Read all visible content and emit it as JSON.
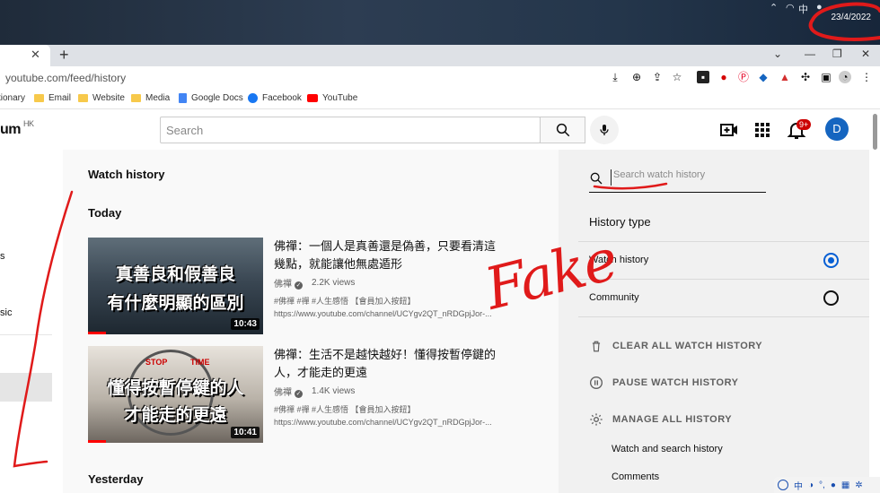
{
  "desktop": {
    "date": "23/4/2022",
    "ime_indicator": "中"
  },
  "browser": {
    "url": "youtube.com/feed/history",
    "bookmarks": [
      {
        "label": "tionary",
        "icon": "folder-icon"
      },
      {
        "label": "Email",
        "icon": "folder-icon"
      },
      {
        "label": "Website",
        "icon": "folder-icon"
      },
      {
        "label": "Media",
        "icon": "folder-icon"
      },
      {
        "label": "Google Docs",
        "icon": "google-docs-icon"
      },
      {
        "label": "Facebook",
        "icon": "facebook-icon"
      },
      {
        "label": "YouTube",
        "icon": "youtube-icon"
      }
    ]
  },
  "youtube": {
    "logo_fragment": "um",
    "region": "HK",
    "search_placeholder": "Search",
    "notification_count": "9+",
    "avatar_letter": "D",
    "sidebar_fragments": [
      "s",
      "sic"
    ]
  },
  "history": {
    "page_title": "Watch history",
    "sections": {
      "today": "Today",
      "yesterday": "Yesterday"
    },
    "videos": [
      {
        "title": "佛禪：一個人是真善還是偽善，只要看清這幾點，就能讓他無處遁形",
        "channel": "佛禪",
        "views": "2.2K views",
        "description": "#佛禪 #禪 #人生感悟 【會員加入按鈕】",
        "link": "https://www.youtube.com/channel/UCYgv2QT_nRDGpjJor-...",
        "duration": "10:43",
        "progress": 0.1,
        "thumb_line1": "真善良和假善良",
        "thumb_line2": "有什麼明顯的區別"
      },
      {
        "title": "佛禪：生活不是越快越好！懂得按暫停鍵的人，才能走的更遠",
        "channel": "佛禪",
        "views": "1.4K views",
        "description": "#佛禪 #禪 #人生感悟 【會員加入按鈕】",
        "link": "https://www.youtube.com/channel/UCYgv2QT_nRDGpjJor-...",
        "duration": "10:41",
        "progress": 0.1,
        "thumb_line1": "懂得按暫停鍵的人",
        "thumb_line2": "才能走的更遠",
        "thumb_stop": "STOP",
        "thumb_time": "TIME"
      }
    ]
  },
  "panel": {
    "search_placeholder": "Search watch history",
    "history_type_label": "History type",
    "types": [
      {
        "label": "Watch history",
        "selected": true
      },
      {
        "label": "Community",
        "selected": false
      }
    ],
    "actions": [
      {
        "label": "CLEAR ALL WATCH HISTORY",
        "icon": "trash-icon"
      },
      {
        "label": "PAUSE WATCH HISTORY",
        "icon": "pause-icon"
      },
      {
        "label": "MANAGE ALL HISTORY",
        "icon": "gear-icon"
      }
    ],
    "sub_links": [
      "Watch and search history",
      "Comments"
    ]
  },
  "annotation": {
    "text": "Fake",
    "color": "#e01a1a"
  },
  "colors": {
    "accent": "#065fd4",
    "badge": "#cc0000",
    "avatar": "#1565c0"
  }
}
